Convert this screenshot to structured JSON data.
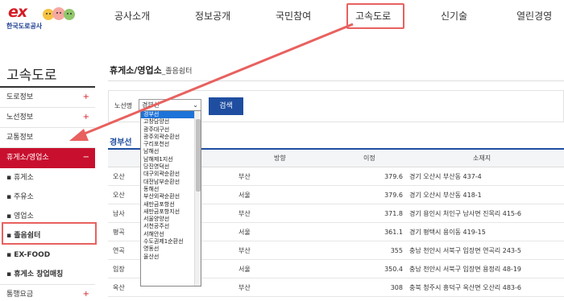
{
  "logo": {
    "brand": "ex",
    "org_name": "한국도로공사"
  },
  "gnb": {
    "items": [
      {
        "label": "공사소개"
      },
      {
        "label": "정보공개"
      },
      {
        "label": "국민참여"
      },
      {
        "label": "고속도로"
      },
      {
        "label": "신기술"
      },
      {
        "label": "열린경영"
      }
    ]
  },
  "sidebar": {
    "title": "고속도로",
    "menu": [
      {
        "label": "도로정보",
        "plus": "+"
      },
      {
        "label": "노선정보",
        "plus": "+"
      },
      {
        "label": "교통정보",
        "plus": ""
      },
      {
        "label": "휴게소/영업소",
        "plus": "−"
      }
    ],
    "sub": [
      {
        "label": "휴게소"
      },
      {
        "label": "주유소"
      },
      {
        "label": "영업소"
      },
      {
        "label": "졸음쉼터"
      },
      {
        "label": "EX-FOOD"
      },
      {
        "label": "휴게소 창업매칭"
      }
    ],
    "bottom": {
      "label": "통행요금",
      "plus": "+"
    }
  },
  "page": {
    "title_main": "휴게소/영업소",
    "title_sub": "_졸음쉼터"
  },
  "search": {
    "label": "노선명",
    "selected": "경부선",
    "button": "검색"
  },
  "route_title": "경부선",
  "table": {
    "headers": {
      "direction": "방향",
      "distance": "이정",
      "location": "소재지"
    },
    "rows": [
      {
        "name": "오산",
        "direction": "부산",
        "distance": "379.6",
        "location": "경기 오산시 부산동 437-4"
      },
      {
        "name": "오산",
        "direction": "서울",
        "distance": "379.6",
        "location": "경기 오산시 부산동 418-1"
      },
      {
        "name": "남사",
        "direction": "부산",
        "distance": "371.8",
        "location": "경기 용인시 처인구 남사면 진목리 415-6"
      },
      {
        "name": "평곡",
        "direction": "서울",
        "distance": "361.1",
        "location": "경기 평택시 용이동 419-15"
      },
      {
        "name": "연곡",
        "direction": "부산",
        "distance": "355",
        "location": "충남 천안시 서북구 입장면 연곡리 243-5"
      },
      {
        "name": "입장",
        "direction": "서울",
        "distance": "350.4",
        "location": "충남 천안시 서북구 입장면 용정리 48-19"
      },
      {
        "name": "옥산",
        "direction": "부산",
        "distance": "308",
        "location": "충북 청주시 흥덕구 옥산면 오산리 483-6"
      }
    ]
  },
  "dropdown": {
    "options": [
      "경부선",
      "고창담양선",
      "광주대구선",
      "광주외곽순환선",
      "구리포천선",
      "남해선",
      "남해제1지선",
      "당진영덕선",
      "대구외곽순환선",
      "대전남부순환선",
      "동해선",
      "부산외곽순환선",
      "새만금포항선",
      "새만금포항지선",
      "서울양양선",
      "서천공주선",
      "서해안선",
      "수도권제1순환선",
      "영동선",
      "울산선"
    ],
    "selected_index": 0
  },
  "colors": {
    "brand_red": "#c8102e",
    "accent_blue": "#1f4ea0",
    "highlight": "#e8615f"
  }
}
